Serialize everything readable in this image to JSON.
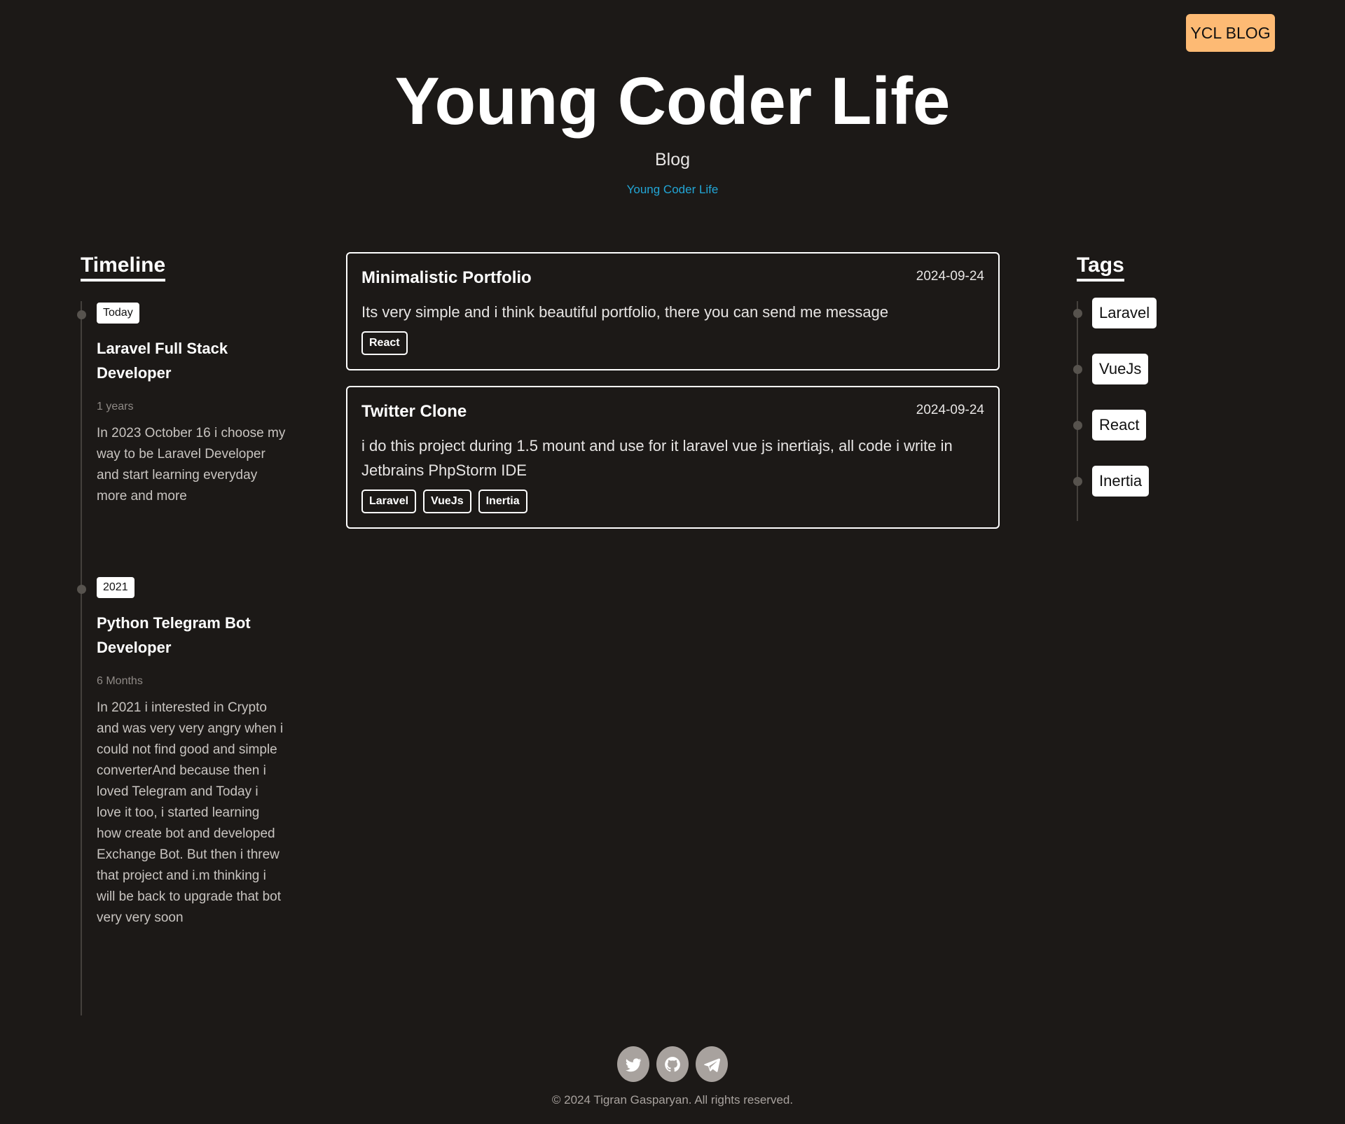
{
  "topbar": {
    "brand_label": "YCL BLOG"
  },
  "header": {
    "title": "Young Coder Life",
    "subtitle": "Blog",
    "link_text": "Young Coder Life"
  },
  "timeline": {
    "heading": "Timeline",
    "items": [
      {
        "badge": "Today",
        "title": "Laravel Full Stack Developer",
        "duration": "1 years",
        "description": "In 2023 October 16 i choose my way to be Laravel Developer and start learning everyday more and more"
      },
      {
        "badge": "2021",
        "title": "Python Telegram Bot Developer",
        "duration": "6 Months",
        "description": "In 2021 i interested in Crypto and was very very angry when i could not find good and simple converterAnd because then i loved Telegram and Today i love it too, i started learning how create bot and developed Exchange Bot. But then i threw that project and i.m thinking i will be back to upgrade that bot very very soon"
      }
    ]
  },
  "posts": [
    {
      "title": "Minimalistic Portfolio",
      "date": "2024-09-24",
      "body": "Its very simple and i think beautiful portfolio, there you can send me message",
      "tags": [
        "React"
      ]
    },
    {
      "title": "Twitter Clone",
      "date": "2024-09-24",
      "body": "i do this project during 1.5 mount and use for it laravel vue js inertiajs, all code i write in Jetbrains PhpStorm IDE",
      "tags": [
        "Laravel",
        "VueJs",
        "Inertia"
      ]
    }
  ],
  "tags": {
    "heading": "Tags",
    "items": [
      "Laravel",
      "VueJs",
      "React",
      "Inertia"
    ]
  },
  "footer": {
    "socials": [
      "twitter-icon",
      "github-icon",
      "telegram-icon"
    ],
    "copyright": "© 2024 Tigran Gasparyan. All rights reserved."
  },
  "colors": {
    "background": "#1c1917",
    "accent": "#fdba74",
    "link": "#22a6d6"
  }
}
